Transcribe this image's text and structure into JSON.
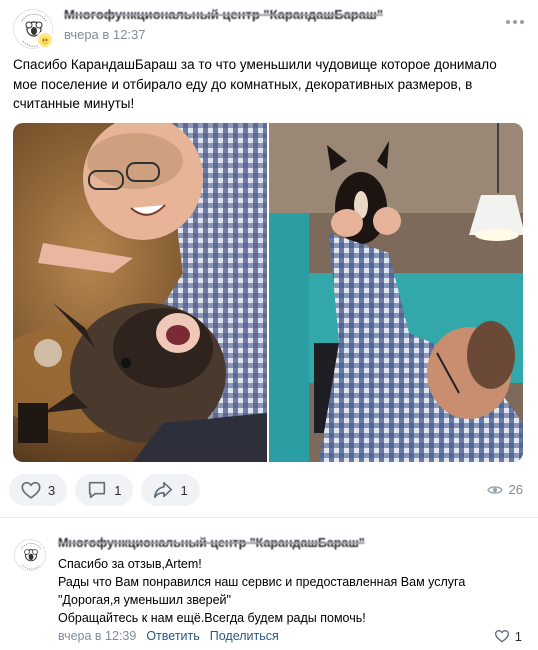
{
  "post": {
    "author": "Многофункциональный центр \"КарандашБараш\"",
    "time": "вчера в 12:37",
    "text": "Спасибо КарандашБараш за то что уменьшили чудовище которое донимало мое поселение и отбирало еду до комнатных, декоративных размеров, в считанные минуты!",
    "photos": [
      {
        "icon": "photo-selfie-with-dog"
      },
      {
        "icon": "photo-man-lifting-dog"
      }
    ],
    "likes": "3",
    "comments": "1",
    "shares": "1",
    "views": "26"
  },
  "comment": {
    "author": "Многофункциональный центр \"КарандашБараш\"",
    "lines": [
      "Спасибо за отзыв,Artem!",
      "Рады что Вам понравился наш сервис и предоставленная Вам услуга",
      "\"Дорогая,я уменьшил зверей\"",
      "Обращайтесь к нам ещё.Всегда будем рады помочь!"
    ],
    "time": "вчера в 12:39",
    "reply_label": "Ответить",
    "share_label": "Поделиться",
    "likes": "1"
  },
  "colors": {
    "accent": "#2a5885",
    "muted": "#818c99",
    "button_bg": "#f0f2f5",
    "divider": "#e7e8ec"
  }
}
